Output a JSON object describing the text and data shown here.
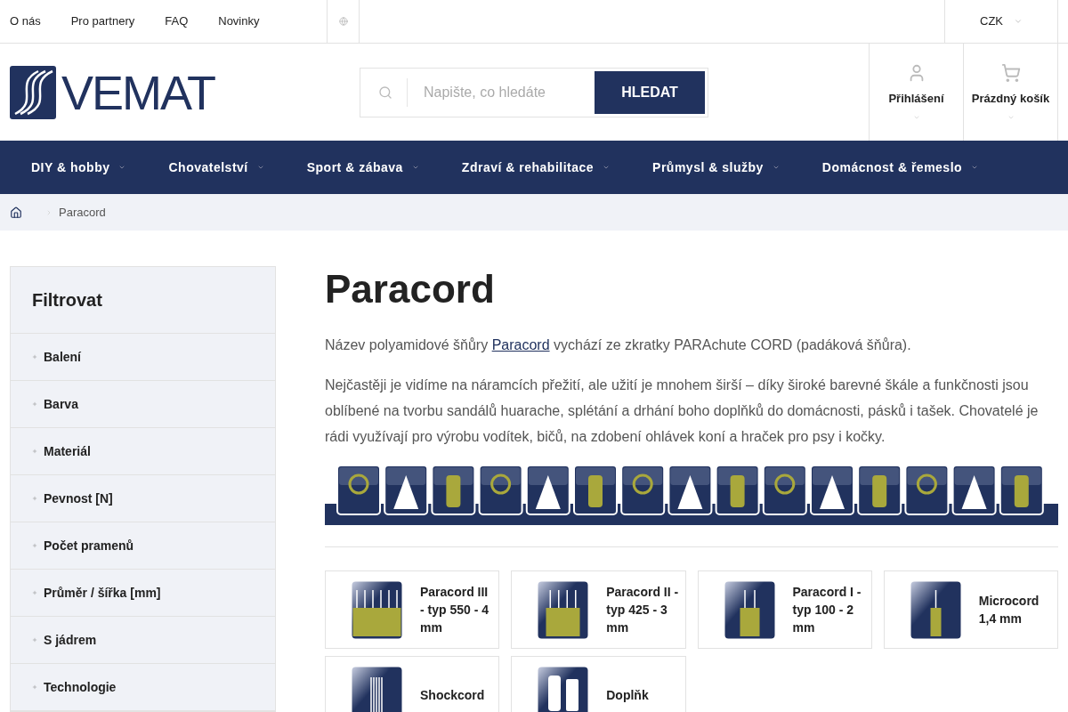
{
  "top_links": [
    "O nás",
    "Pro partnery",
    "FAQ",
    "Novinky"
  ],
  "currency": "CZK",
  "logo": "VEMAT",
  "search": {
    "placeholder": "Napište, co hledáte",
    "button": "HLEDAT"
  },
  "account": [
    "Přihlášení",
    "Prázdný košík"
  ],
  "nav": [
    "DIY & hobby",
    "Chovatelství",
    "Sport & zábava",
    "Zdraví & rehabilitace",
    "Průmysl & služby",
    "Domácnost & řemeslo"
  ],
  "breadcrumb": [
    "Paracord"
  ],
  "filter": {
    "title": "Filtrovat",
    "items": [
      "Balení",
      "Barva",
      "Materiál",
      "Pevnost [N]",
      "Počet pramenů",
      "Průměr / šířka [mm]",
      "S jádrem",
      "Technologie"
    ]
  },
  "title": "Paracord",
  "intro": {
    "before": "Název polyamidové šňůry ",
    "link": "Paracord",
    "after": " vychází ze zkratky PARAchute CORD (padáková šňůra)."
  },
  "paragraph": "Nejčastěji je vidíme na náramcích přežití, ale užití je mnohem širší – díky široké barevné škále a funkčnosti jsou oblíbené na tvorbu sandálů huarache, splétání a drhání boho doplňků do domácnosti, pásků i tašek. Chovatelé je rádi využívají pro výrobu vodítek, bičů, na zdobení ohlávek koní a hraček pro psy i kočky.",
  "categories": [
    {
      "label": "Paracord III - typ 550 - 4 mm",
      "kind": "wide"
    },
    {
      "label": "Paracord II - typ 425 - 3 mm",
      "kind": "medium"
    },
    {
      "label": "Paracord I - typ 100 - 2 mm",
      "kind": "narrow"
    },
    {
      "label": "Microcord 1,4 mm",
      "kind": "micro"
    },
    {
      "label": "Shockcord",
      "kind": "shock"
    },
    {
      "label": "Doplňk",
      "kind": "accessory"
    }
  ]
}
